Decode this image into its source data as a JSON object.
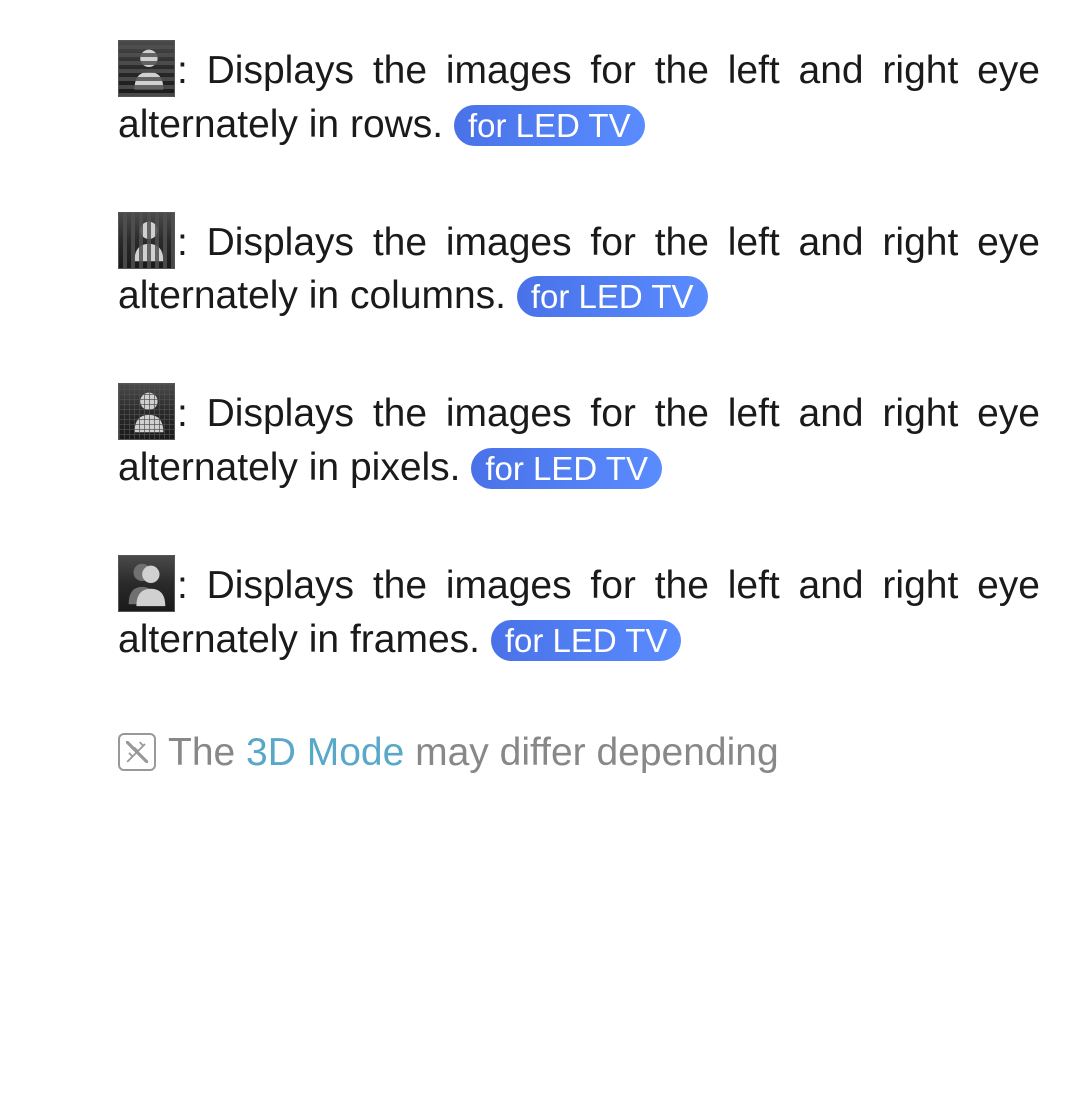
{
  "items": [
    {
      "icon": "rows",
      "desc": ": Displays the images for the left and right eye alternately in rows.",
      "badge": "for LED TV"
    },
    {
      "icon": "columns",
      "desc": ": Displays the images for the left and right eye alternately in columns.",
      "badge": "for LED TV"
    },
    {
      "icon": "pixels",
      "desc": ": Displays the images for the left and right eye alternately in pixels.",
      "badge": "for LED TV"
    },
    {
      "icon": "frames",
      "desc": ": Displays the images for the left and right eye alternately in frames.",
      "badge": "for LED TV"
    }
  ],
  "note": {
    "prefix": "The ",
    "highlight": "3D Mode",
    "suffix": " may differ depending"
  }
}
